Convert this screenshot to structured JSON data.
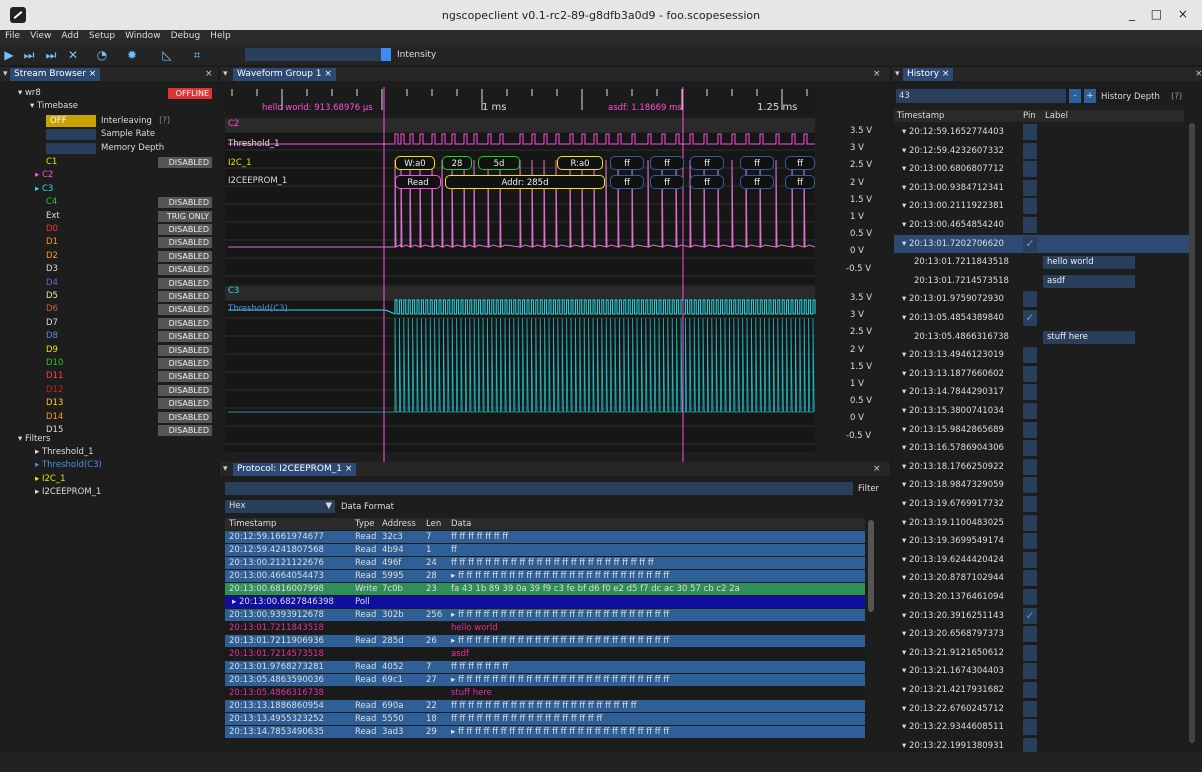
{
  "window": {
    "title": "ngscopeclient v0.1-rc2-89-g8dfb3a0d9 - foo.scopesession",
    "controls": "_ □ ×"
  },
  "menu": [
    "File",
    "View",
    "Add",
    "Setup",
    "Window",
    "Debug",
    "Help"
  ],
  "toolbar": {
    "intensity_label": "Intensity"
  },
  "stream_browser": {
    "tab": "Stream Browser ×",
    "close": "×",
    "instrument": "▾ wr8",
    "status": "OFFLINE",
    "timebase": "▾ Timebase",
    "interleaving_value": "OFF",
    "interleaving_label": "Interleaving",
    "interleaving_help": "(?)",
    "sample_rate": "Sample Rate",
    "memory_depth": "Memory Depth",
    "channels": [
      {
        "name": "C1",
        "color": "#e8e800",
        "state": "DISABLED"
      },
      {
        "name": "▸ C2",
        "color": "#ff4fe0",
        "state": ""
      },
      {
        "name": "▸ C3",
        "color": "#28e0e8",
        "state": ""
      },
      {
        "name": "C4",
        "color": "#22cc22",
        "state": "DISABLED"
      },
      {
        "name": "Ext",
        "color": "#dddddd",
        "state": "TRIG ONLY"
      },
      {
        "name": "D0",
        "color": "#ff3030",
        "state": "DISABLED"
      },
      {
        "name": "D1",
        "color": "#ff9a1a",
        "state": "DISABLED"
      },
      {
        "name": "D2",
        "color": "#ff9a1a",
        "state": "DISABLED"
      },
      {
        "name": "D3",
        "color": "#dddddd",
        "state": "DISABLED"
      },
      {
        "name": "D4",
        "color": "#7a5cc8",
        "state": "DISABLED"
      },
      {
        "name": "D5",
        "color": "#e8e8a8",
        "state": "DISABLED"
      },
      {
        "name": "D6",
        "color": "#d0603a",
        "state": "DISABLED"
      },
      {
        "name": "D7",
        "color": "#dddddd",
        "state": "DISABLED"
      },
      {
        "name": "D8",
        "color": "#4f8ee8",
        "state": "DISABLED"
      },
      {
        "name": "D9",
        "color": "#e8e800",
        "state": "DISABLED"
      },
      {
        "name": "D10",
        "color": "#22cc22",
        "state": "DISABLED"
      },
      {
        "name": "D11",
        "color": "#ff4444",
        "state": "DISABLED"
      },
      {
        "name": "D12",
        "color": "#d02020",
        "state": "DISABLED"
      },
      {
        "name": "D13",
        "color": "#ffcc22",
        "state": "DISABLED"
      },
      {
        "name": "D14",
        "color": "#ff9a1a",
        "state": "DISABLED"
      },
      {
        "name": "D15",
        "color": "#dddddd",
        "state": "DISABLED"
      }
    ],
    "filters": "▾ Filters",
    "filter_items": [
      {
        "name": "▸ Threshold_1",
        "color": "#dddddd"
      },
      {
        "name": "▸ Threshold(C3)",
        "color": "#4f8ee8"
      },
      {
        "name": "▸ I2C_1",
        "color": "#e8e800"
      },
      {
        "name": "▸ I2CEEPROM_1",
        "color": "#dddddd"
      }
    ]
  },
  "waveform": {
    "tab": "Waveform Group 1 ×",
    "close": "×",
    "marker1": "hello world: 913.68976 µs",
    "marker2": "asdf: 1.18669 ms",
    "tick1": "1 ms",
    "tick2": "1.25 ms",
    "c2_label": "C2",
    "threshold1": "Threshold_1",
    "i2c1": "I2C_1",
    "eeprom1": "I2CEEPROM_1",
    "c3_label": "C3",
    "threshold_c3": "Threshold(C3)",
    "volts": [
      "3.5 V",
      "3 V",
      "2.5 V",
      "2 V",
      "1.5 V",
      "1 V",
      "0.5 V",
      "0 V",
      "-0.5 V"
    ],
    "i2c_packets": [
      "W:a0",
      "28",
      "5d",
      "R:a0",
      "ff",
      "ff",
      "ff",
      "ff",
      "ff"
    ],
    "eeprom_packets": [
      "Read",
      "Addr: 285d",
      "ff",
      "ff",
      "ff",
      "ff",
      "ff"
    ]
  },
  "protocol": {
    "tab": "Protocol: I2CEEPROM_1 ×",
    "close": "×",
    "filter_label": "Filter",
    "format_value": "Hex",
    "format_label": "Data Format",
    "columns": [
      "Timestamp",
      "Type",
      "Address",
      "Len",
      "Data"
    ],
    "rows": [
      {
        "ts": "20:12:59.1661974677",
        "type": "Read",
        "addr": "32c3",
        "len": "7",
        "data": "ff ff ff ff ff ff ff",
        "kind": "n"
      },
      {
        "ts": "20:12:59.4241807568",
        "type": "Read",
        "addr": "4b94",
        "len": "1",
        "data": "ff",
        "kind": "n"
      },
      {
        "ts": "20:13:00.2121122676",
        "type": "Read",
        "addr": "496f",
        "len": "24",
        "data": "ff ff ff ff ff ff ff ff ff ff ff ff ff ff ff ff ff ff ff ff ff ff ff ff",
        "kind": "n"
      },
      {
        "ts": "20:13:00.4664054473",
        "type": "Read",
        "addr": "5995",
        "len": "28",
        "data": "▸      ff ff ff ff ff ff ff ff ff ff ff ff ff ff ff ff ff ff ff ff ff ff ff ff ff",
        "kind": "n"
      },
      {
        "ts": "20:13:00.6816007998",
        "type": "Write",
        "addr": "7c0b",
        "len": "23",
        "data": "fa 43 1b 89 39 0a 39 f9 c3 fe bf d6 f0 e2 d5 f7 dc ac 30 57 cb c2 2a",
        "kind": "w"
      },
      {
        "ts": "▸  20:13:00.6827846398",
        "type": "Poll",
        "addr": "",
        "len": "",
        "data": "",
        "kind": "p"
      },
      {
        "ts": "20:13:00.9393912678",
        "type": "Read",
        "addr": "302b",
        "len": "256",
        "data": "▸      ff ff ff ff ff ff ff ff ff ff ff ff ff ff ff ff ff ff ff ff ff ff ff ff ff",
        "kind": "n"
      },
      {
        "ts": "20:13:01.7211843518",
        "type": "",
        "addr": "",
        "len": "",
        "data": "hello world",
        "kind": "m"
      },
      {
        "ts": "20:13:01.7211906936",
        "type": "Read",
        "addr": "285d",
        "len": "26",
        "data": "▸      ff ff ff ff ff ff ff ff ff ff ff ff ff ff ff ff ff ff ff ff ff ff ff ff ff",
        "kind": "n"
      },
      {
        "ts": "20:13:01.7214573518",
        "type": "",
        "addr": "",
        "len": "",
        "data": "asdf",
        "kind": "m"
      },
      {
        "ts": "20:13:01.9768273281",
        "type": "Read",
        "addr": "4052",
        "len": "7",
        "data": "ff ff ff ff ff ff ff",
        "kind": "n"
      },
      {
        "ts": "20:13:05.4863590036",
        "type": "Read",
        "addr": "69c1",
        "len": "27",
        "data": "▸      ff ff ff ff ff ff ff ff ff ff ff ff ff ff ff ff ff ff ff ff ff ff ff ff ff",
        "kind": "n"
      },
      {
        "ts": "20:13:05.4866316738",
        "type": "",
        "addr": "",
        "len": "",
        "data": "stuff here",
        "kind": "m"
      },
      {
        "ts": "20:13:13.1886860954",
        "type": "Read",
        "addr": "690a",
        "len": "22",
        "data": "ff ff ff ff ff ff ff ff ff ff ff ff ff ff ff ff ff ff ff ff ff ff",
        "kind": "n"
      },
      {
        "ts": "20:13:13.4955323252",
        "type": "Read",
        "addr": "5550",
        "len": "18",
        "data": "ff ff ff ff ff ff ff ff ff ff ff ff ff ff ff ff ff ff",
        "kind": "n"
      },
      {
        "ts": "20:13:14.7853490635",
        "type": "Read",
        "addr": "3ad3",
        "len": "29",
        "data": "▸      ff ff ff ff ff ff ff ff ff ff ff ff ff ff ff ff ff ff ff ff ff ff ff ff ff",
        "kind": "n"
      }
    ]
  },
  "history": {
    "tab": "History ×",
    "close": "×",
    "depth_value": "43",
    "minus": "-",
    "plus": "+",
    "depth_label": "History Depth",
    "help": "(?)",
    "columns": [
      "Timestamp",
      "Pin",
      "Label"
    ],
    "rows": [
      {
        "ts": "▾  20:12:59.1652774403",
        "pin": "",
        "label": "",
        "sub": false
      },
      {
        "ts": "▾  20:12:59.4232607332",
        "pin": "",
        "label": "",
        "sub": false
      },
      {
        "ts": "▾  20:13:00.6806807712",
        "pin": "",
        "label": "",
        "sub": false
      },
      {
        "ts": "▾  20:13:00.9384712341",
        "pin": "",
        "label": "",
        "sub": false
      },
      {
        "ts": "▾  20:13:00.2111922381",
        "pin": "",
        "label": "",
        "sub": false
      },
      {
        "ts": "▾  20:13:00.4654854240",
        "pin": "",
        "label": "",
        "sub": false
      },
      {
        "ts": "▾  20:13:01.7202706620",
        "pin": "✓",
        "label": "",
        "sub": false,
        "sel": true
      },
      {
        "ts": "20:13:01.7211843518",
        "pin": "",
        "label": "hello world",
        "sub": true
      },
      {
        "ts": "20:13:01.7214573518",
        "pin": "",
        "label": "asdf",
        "sub": true
      },
      {
        "ts": "▾  20:13:01.9759072930",
        "pin": "",
        "label": "",
        "sub": false
      },
      {
        "ts": "▾  20:13:05.4854389840",
        "pin": "✓",
        "label": "",
        "sub": false
      },
      {
        "ts": "20:13:05.4866316738",
        "pin": "",
        "label": "stuff here",
        "sub": true
      },
      {
        "ts": "▾  20:13:13.4946123019",
        "pin": "",
        "label": "",
        "sub": false
      },
      {
        "ts": "▾  20:13:13.1877660602",
        "pin": "",
        "label": "",
        "sub": false
      },
      {
        "ts": "▾  20:13:14.7844290317",
        "pin": "",
        "label": "",
        "sub": false
      },
      {
        "ts": "▾  20:13:15.3800741034",
        "pin": "",
        "label": "",
        "sub": false
      },
      {
        "ts": "▾  20:13:15.9842865689",
        "pin": "",
        "label": "",
        "sub": false
      },
      {
        "ts": "▾  20:13:16.5786904306",
        "pin": "",
        "label": "",
        "sub": false
      },
      {
        "ts": "▾  20:13:18.1766250922",
        "pin": "",
        "label": "",
        "sub": false
      },
      {
        "ts": "▾  20:13:18.9847329059",
        "pin": "",
        "label": "",
        "sub": false
      },
      {
        "ts": "▾  20:13:19.6769917732",
        "pin": "",
        "label": "",
        "sub": false
      },
      {
        "ts": "▾  20:13:19.1100483025",
        "pin": "",
        "label": "",
        "sub": false
      },
      {
        "ts": "▾  20:13:19.3699549174",
        "pin": "",
        "label": "",
        "sub": false
      },
      {
        "ts": "▾  20:13:19.6244420424",
        "pin": "",
        "label": "",
        "sub": false
      },
      {
        "ts": "▾  20:13:20.8787102944",
        "pin": "",
        "label": "",
        "sub": false
      },
      {
        "ts": "▾  20:13:20.1376461094",
        "pin": "",
        "label": "",
        "sub": false
      },
      {
        "ts": "▾  20:13:20.3916251143",
        "pin": "✓",
        "label": "",
        "sub": false
      },
      {
        "ts": "▾  20:13:20.6568797373",
        "pin": "",
        "label": "",
        "sub": false
      },
      {
        "ts": "▾  20:13:21.9121650612",
        "pin": "",
        "label": "",
        "sub": false
      },
      {
        "ts": "▾  20:13:21.1674304403",
        "pin": "",
        "label": "",
        "sub": false
      },
      {
        "ts": "▾  20:13:21.4217931682",
        "pin": "",
        "label": "",
        "sub": false
      },
      {
        "ts": "▾  20:13:22.6760245712",
        "pin": "",
        "label": "",
        "sub": false
      },
      {
        "ts": "▾  20:13:22.9344608511",
        "pin": "",
        "label": "",
        "sub": false
      },
      {
        "ts": "▾  20:13:22.1991380931",
        "pin": "",
        "label": "",
        "sub": false
      }
    ]
  }
}
